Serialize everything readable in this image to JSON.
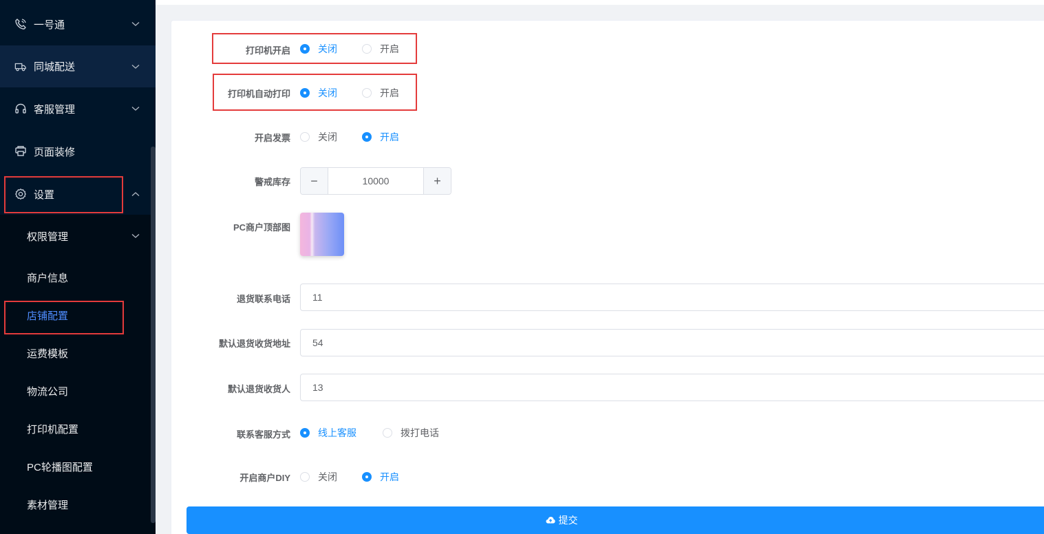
{
  "sidebar": {
    "menu": [
      {
        "label": "一号通",
        "icon": "phone-icon"
      },
      {
        "label": "同城配送",
        "icon": "truck-icon"
      },
      {
        "label": "客服管理",
        "icon": "headset-icon"
      },
      {
        "label": "页面装修",
        "icon": "printer-icon"
      },
      {
        "label": "设置",
        "icon": "gear-icon"
      }
    ],
    "submenu": [
      {
        "label": "权限管理"
      },
      {
        "label": "商户信息"
      },
      {
        "label": "店铺配置"
      },
      {
        "label": "运费模板"
      },
      {
        "label": "物流公司"
      },
      {
        "label": "打印机配置"
      },
      {
        "label": "PC轮播图配置"
      },
      {
        "label": "素材管理"
      }
    ],
    "active_submenu": "店铺配置",
    "colors": {
      "background": "#001529",
      "active": "#4f8dff"
    }
  },
  "form": {
    "printer_enable": {
      "label": "打印机开启",
      "options": [
        "关闭",
        "开启"
      ],
      "selected": "关闭"
    },
    "printer_auto_print": {
      "label": "打印机自动打印",
      "options": [
        "关闭",
        "开启"
      ],
      "selected": "关闭"
    },
    "invoice_enable": {
      "label": "开启发票",
      "options": [
        "关闭",
        "开启"
      ],
      "selected": "开启"
    },
    "stock_warning": {
      "label": "警戒库存",
      "value": "10000",
      "minus": "−",
      "plus": "+"
    },
    "pc_top_image": {
      "label": "PC商户顶部图"
    },
    "return_phone": {
      "label": "退货联系电话",
      "value": "11"
    },
    "return_address": {
      "label": "默认退货收货地址",
      "value": "54"
    },
    "return_receiver": {
      "label": "默认退货收货人",
      "value": "13"
    },
    "service_method": {
      "label": "联系客服方式",
      "options": [
        "线上客服",
        "拨打电话"
      ],
      "selected": "线上客服"
    },
    "merchant_diy": {
      "label": "开启商户DIY",
      "options": [
        "关闭",
        "开启"
      ],
      "selected": "开启"
    },
    "submit_label": "提交"
  },
  "colors": {
    "primary": "#1890ff",
    "highlight_border": "#e43b3b"
  }
}
